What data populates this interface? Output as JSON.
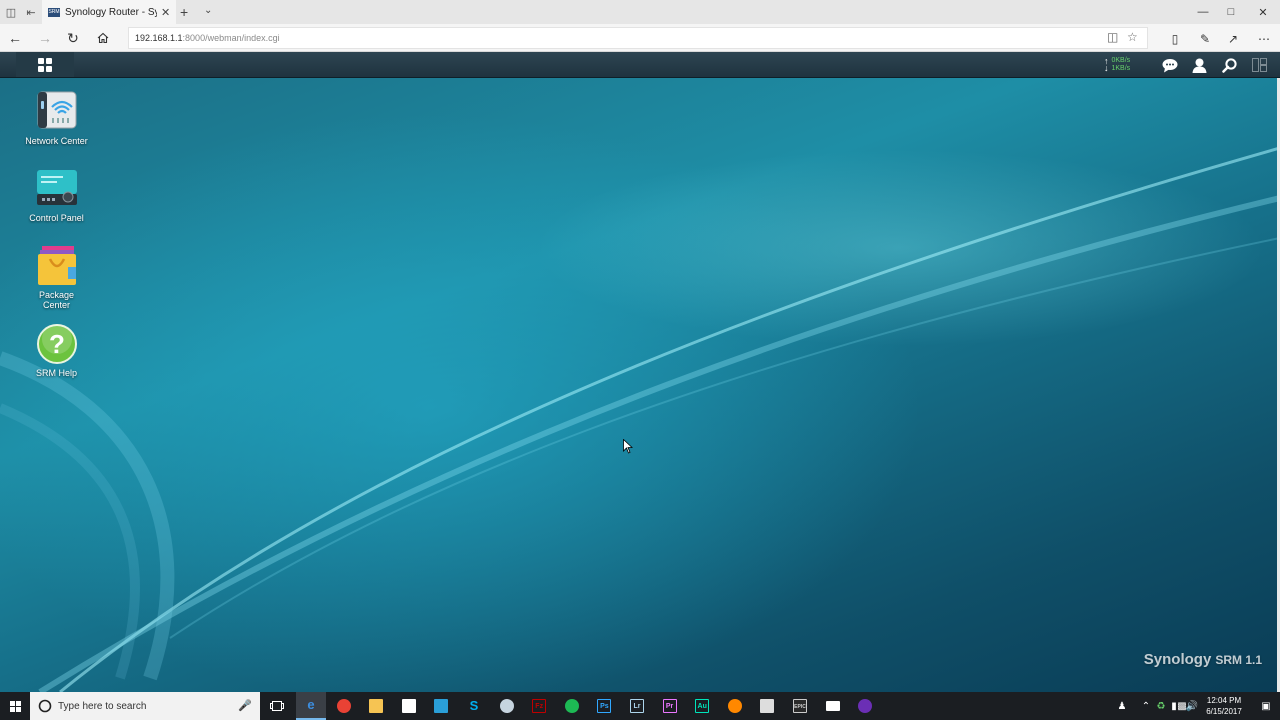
{
  "browser": {
    "tab_title": "Synology Router - Syno",
    "favicon_text": "SRM",
    "url_host": "192.168.1.1",
    "url_path": ":8000/webman/index.cgi"
  },
  "srm": {
    "upload_speed": "0KB/s",
    "download_speed": "1KB/s",
    "brand": "Synology",
    "product": "SRM 1.1",
    "desktop_icons": [
      {
        "label": "Network Center"
      },
      {
        "label": "Control Panel"
      },
      {
        "label": "Package Center"
      },
      {
        "label": "SRM Help"
      }
    ]
  },
  "taskbar": {
    "search_placeholder": "Type here to search",
    "time": "12:04 PM",
    "date": "6/15/2017",
    "apps": [
      {
        "name": "edge",
        "text": "e",
        "color": "#3c8ee0"
      },
      {
        "name": "chrome",
        "text": "",
        "color": "#e94235"
      },
      {
        "name": "file-explorer",
        "text": "",
        "color": "#f6c453"
      },
      {
        "name": "store",
        "text": "",
        "color": "#ffffff"
      },
      {
        "name": "app-blue",
        "text": "",
        "color": "#2a9fd8"
      },
      {
        "name": "skype",
        "text": "S",
        "color": "#00aff0"
      },
      {
        "name": "steam",
        "text": "",
        "color": "#c6d4df"
      },
      {
        "name": "filezilla",
        "text": "Fz",
        "color": "#bf0000"
      },
      {
        "name": "spotify",
        "text": "",
        "color": "#1db954"
      },
      {
        "name": "photoshop",
        "text": "Ps",
        "color": "#31a8ff"
      },
      {
        "name": "lightroom",
        "text": "Lr",
        "color": "#add5ec"
      },
      {
        "name": "premiere",
        "text": "Pr",
        "color": "#ea77ff"
      },
      {
        "name": "audition",
        "text": "Au",
        "color": "#00e4bb"
      },
      {
        "name": "vlc",
        "text": "",
        "color": "#ff8800"
      },
      {
        "name": "app-curve",
        "text": "",
        "color": "#dddddd"
      },
      {
        "name": "epic-games",
        "text": "EPIC",
        "color": "#cccccc"
      },
      {
        "name": "mail",
        "text": "",
        "color": "#ffffff"
      },
      {
        "name": "app-drop",
        "text": "",
        "color": "#6b2fb5"
      }
    ]
  }
}
